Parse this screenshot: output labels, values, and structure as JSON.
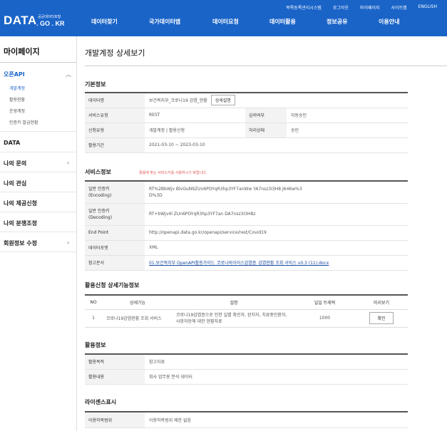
{
  "header": {
    "logo_main": "DATA",
    "logo_sub": "공공데이터포털",
    "logo_domain": ". GO . KR",
    "util_links": [
      "목록등록관리시스템",
      "로그아웃",
      "마이페이지",
      "사이트맵",
      "ENGLISH"
    ],
    "nav": [
      "데이터찾기",
      "국가데이터맵",
      "데이터요청",
      "데이터활용",
      "정보공유",
      "이용안내"
    ]
  },
  "sidebar": {
    "title": "마이페이지",
    "open_api": "오픈API",
    "sub_items": [
      "개발계정",
      "활용현황",
      "운영계정",
      "인증키 발급현황"
    ],
    "items": [
      "DATA",
      "나의 문의",
      "나의 관심",
      "나의 제공신청",
      "나의 분쟁조정",
      "회원정보 수정"
    ]
  },
  "page_title": "개발계정 상세보기",
  "basic": {
    "title": "기본정보",
    "data_name_label": "데이터명",
    "data_name": "보건복지부_코로나19 감염_현황",
    "detail_button": "상세설명",
    "service_type_label": "서비스유형",
    "service_type": "REST",
    "review_label": "심의여부",
    "review": "자동승인",
    "apply_type_label": "신청유형",
    "apply_type": "개발계정 | 활용신청",
    "process_label": "처리상태",
    "process": "승인",
    "period_label": "활용기간",
    "period": "2021-03-10 ~ 2023-03-10"
  },
  "service": {
    "title": "서비스정보",
    "note": "활용에 맞는 서비스키를 사용하시기 바랍니다.",
    "enc_label_1": "일반 인증키",
    "enc_label_2": "(Encoding)",
    "enc_key_1": "RT%2BbWjv          BlvGuN9ZUn6POYqR3hp3YF7anWw          YA7nsz3I3H8          J646w%3",
    "enc_key_2": "D%3D",
    "dec_label_1": "일반 인증키",
    "dec_label_2": "(Decoding)",
    "dec_key": "RT+bWjv4l               ZUn6POYqR3hp3YF7an               DA7nsz3I3H8z",
    "endpoint_label": "End Point",
    "endpoint": "http://openapi.data.go.kr/openapi/service/rest/Covid19",
    "format_label": "데이터포맷",
    "format": "XML",
    "doc_label": "참고문서",
    "doc": "01.보건복지부 OpenAPI활용가이드_코로나바이러스감염증_감염현황 조회 서비스 v0.3 (11).docx"
  },
  "functions": {
    "title": "활용신청 상세기능정보",
    "headers": [
      "NO",
      "상세기능",
      "설명",
      "일일 트래픽",
      "미리보기"
    ],
    "rows": [
      {
        "no": "1",
        "name": "코로나19감염현황 조회 서비스",
        "desc": "코로나19감염증으로 인한 일별 확진자, 완치자, 치료중인환자, 사망자등에 대한 현황자료",
        "traffic": "1000",
        "preview": "확인"
      }
    ]
  },
  "usage": {
    "title": "활용정보",
    "purpose_label": "활용목적",
    "purpose": "참고자료",
    "content_label": "활용내용",
    "content": "회사 업무용 분석 데이터"
  },
  "license": {
    "title": "라이센스표시",
    "range_label": "이용허락범위",
    "range": "이용허락범위 제한 없음"
  }
}
